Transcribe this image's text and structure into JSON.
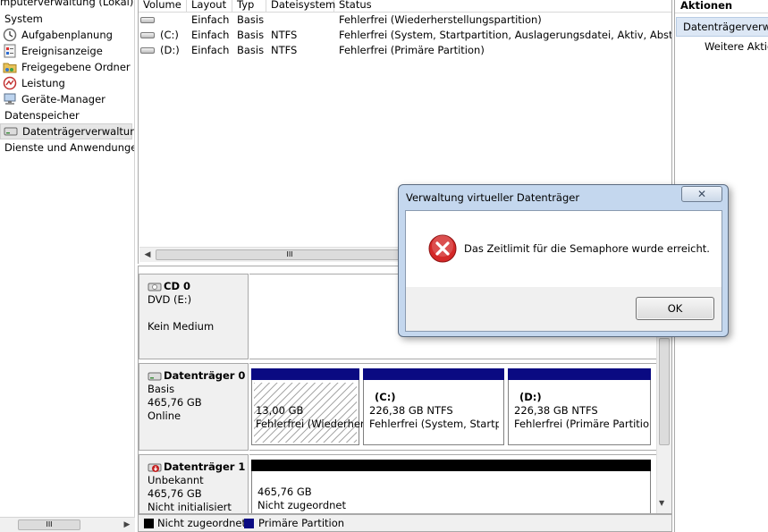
{
  "tree": {
    "root_label": "mputerverwaltung (Lokal)",
    "items": [
      {
        "label": "System",
        "icon": "none"
      },
      {
        "label": "Aufgabenplanung",
        "icon": "clock-icon"
      },
      {
        "label": "Ereignisanzeige",
        "icon": "event-viewer-icon"
      },
      {
        "label": "Freigegebene Ordner",
        "icon": "shared-folder-icon"
      },
      {
        "label": "Leistung",
        "icon": "performance-icon"
      },
      {
        "label": "Geräte-Manager",
        "icon": "device-manager-icon"
      },
      {
        "label": "Datenspeicher",
        "icon": "none"
      },
      {
        "label": "Datenträgerverwaltung",
        "icon": "disk-management-icon",
        "selected": true
      },
      {
        "label": "Dienste und Anwendungen",
        "icon": "none"
      }
    ],
    "scroll_thumb_glyph": "III"
  },
  "volumes": {
    "columns": [
      "Volume",
      "Layout",
      "Typ",
      "Dateisystem",
      "Status"
    ],
    "rows": [
      {
        "volume": "",
        "layout": "Einfach",
        "typ": "Basis",
        "fs": "",
        "status": "Fehlerfrei (Wiederherstellungspartition)"
      },
      {
        "volume": "(C:)",
        "layout": "Einfach",
        "typ": "Basis",
        "fs": "NTFS",
        "status": "Fehlerfrei (System, Startpartition, Auslagerungsdatei, Aktiv, Absturzabb"
      },
      {
        "volume": "(D:)",
        "layout": "Einfach",
        "typ": "Basis",
        "fs": "NTFS",
        "status": "Fehlerfrei (Primäre Partition)"
      }
    ],
    "scroll_thumb_glyph": "III"
  },
  "disks": [
    {
      "name": "CD 0",
      "line2": "DVD (E:)",
      "line3": "",
      "line4": "Kein Medium",
      "icon": "cd-drive-icon"
    },
    {
      "name": "Datenträger 0",
      "line2": "Basis",
      "line3": "465,76 GB",
      "line4": "Online",
      "icon": "hard-disk-icon",
      "partitions": [
        {
          "label": "",
          "size": "13,00 GB",
          "status": "Fehlerfrei (Wiederher"
        },
        {
          "label": "(C:)",
          "size": "226,38 GB NTFS",
          "status": "Fehlerfrei (System, Startpart"
        },
        {
          "label": "(D:)",
          "size": "226,38 GB NTFS",
          "status": "Fehlerfrei (Primäre Partition)"
        }
      ]
    },
    {
      "name": "Datenträger 1",
      "line2": "Unbekannt",
      "line3": "465,76 GB",
      "line4": "Nicht initialisiert",
      "icon": "uninitialized-disk-icon",
      "partitions": [
        {
          "label": "",
          "size": "465,76 GB",
          "status": "Nicht zugeordnet"
        }
      ]
    }
  ],
  "legend": [
    {
      "label": "Nicht zugeordnet",
      "color": "#000000"
    },
    {
      "label": "Primäre Partition",
      "color": "#0a0a82"
    }
  ],
  "actions": {
    "title": "Aktionen",
    "section": "Datenträgerverwaltung",
    "more": "Weitere Aktio"
  },
  "dialog": {
    "title": "Verwaltung virtueller Datenträger",
    "close_glyph": "✕",
    "message": "Das Zeitlimit für die Semaphore wurde erreicht.",
    "ok_label": "OK",
    "icon": "error-icon"
  },
  "colors": {
    "primary_partition": "#0a0a82",
    "unallocated": "#000000",
    "dialog_frame": "#c4d7ee",
    "error_red": "#d42828"
  }
}
